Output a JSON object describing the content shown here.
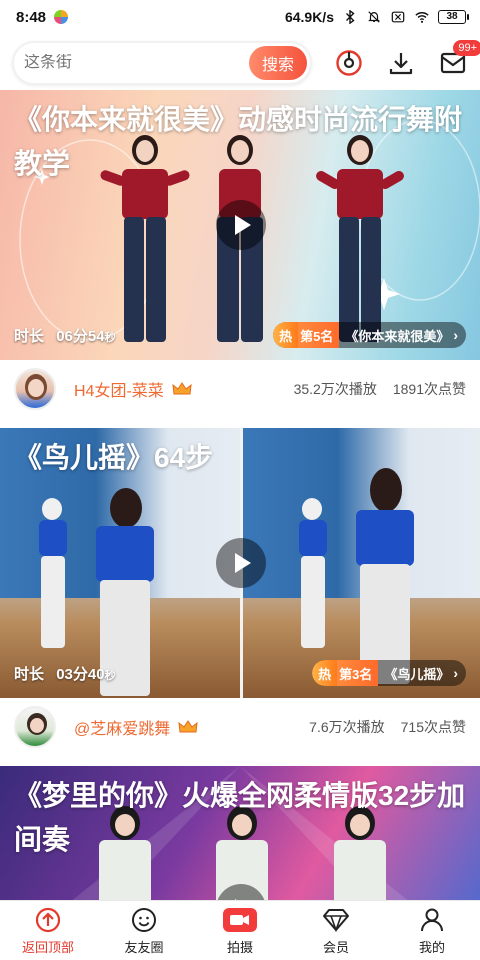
{
  "status_bar": {
    "time": "8:48",
    "network_speed": "64.9K/s",
    "battery": "38"
  },
  "search": {
    "placeholder": "这条街",
    "button_label": "搜索",
    "message_badge": "99+"
  },
  "feed": [
    {
      "title": "《你本来就很美》动感时尚流行舞附教学",
      "duration_label": "时长",
      "duration_main": "06分54",
      "duration_sec": "秒",
      "rank_hot": "热",
      "rank_place": "第5名",
      "rank_song": "《你本来就很美》",
      "author": "H4女团-菜菜",
      "plays": "35.2万次播放",
      "likes": "1891次点赞"
    },
    {
      "title": "《鸟儿摇》64步",
      "duration_label": "时长",
      "duration_main": "03分40",
      "duration_sec": "秒",
      "rank_hot": "热",
      "rank_place": "第3名",
      "rank_song": "《鸟儿摇》",
      "author": "@芝麻爱跳舞",
      "plays": "7.6万次播放",
      "likes": "715次点赞"
    },
    {
      "title": "《梦里的你》火爆全网柔情版32步加间奏"
    }
  ],
  "bottom_nav": [
    {
      "label": "返回顶部",
      "icon": "arrow-up-circle-icon"
    },
    {
      "label": "友友圈",
      "icon": "smile-face-icon"
    },
    {
      "label": "拍摄",
      "icon": "video-camera-icon"
    },
    {
      "label": "会员",
      "icon": "diamond-icon"
    },
    {
      "label": "我的",
      "icon": "person-icon"
    }
  ],
  "colors": {
    "accent": "#f5533d",
    "author_name": "#ee6a32",
    "nav_active": "#e33a2c"
  }
}
